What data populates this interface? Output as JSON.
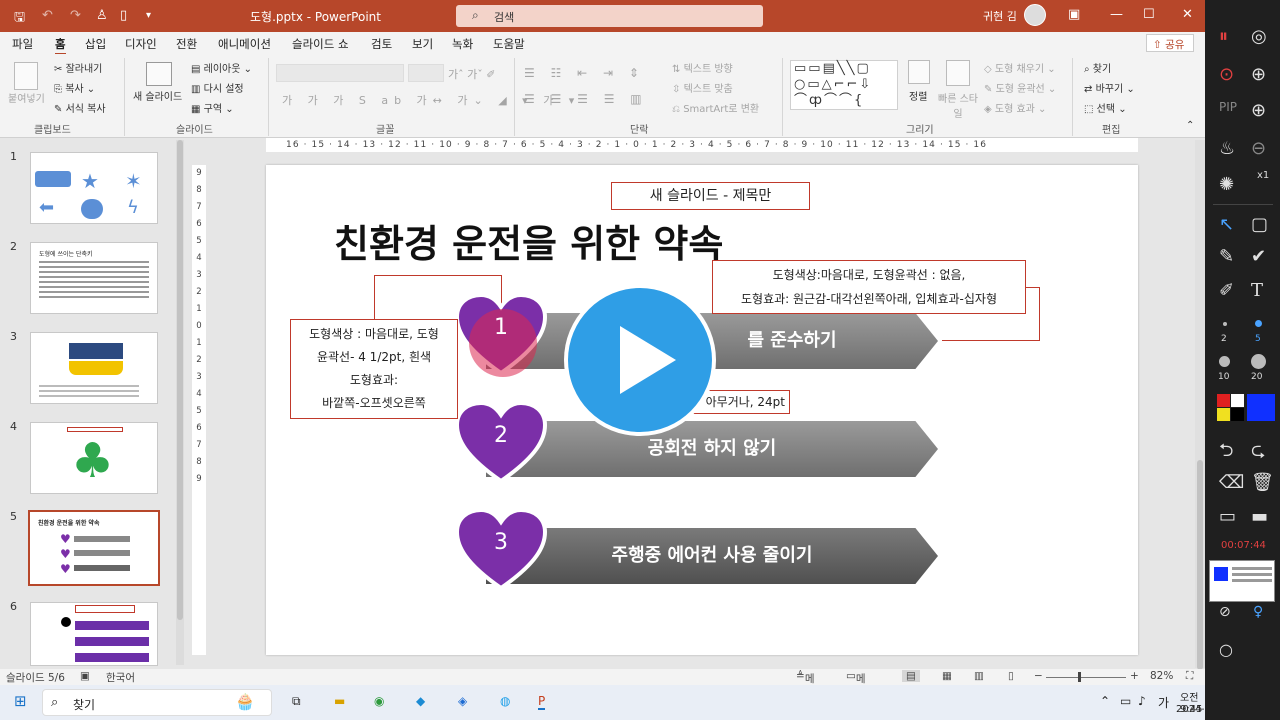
{
  "titlebar": {
    "doc": "도형.pptx  -  PowerPoint",
    "search": "검색",
    "user": "귀현 김"
  },
  "menu": [
    "파일",
    "홈",
    "삽입",
    "디자인",
    "전환",
    "애니메이션",
    "슬라이드 쇼",
    "검토",
    "보기",
    "녹화",
    "도움말"
  ],
  "share": "공유",
  "ribbon": {
    "paste": "붙여넣기",
    "cut": "잘라내기",
    "copy": "복사",
    "format_painter": "서식 복사",
    "new_slide": "새 슬라이드",
    "layout": "레이아웃",
    "reset": "다시 설정",
    "section": "구역",
    "text_dir": "텍스트 방향",
    "align_text": "텍스트 맞춤",
    "smartart": "SmartArt로 변환",
    "arrange": "정렬",
    "quick_styles": "빠른 스타일",
    "shape_fill": "도형 채우기",
    "shape_outline": "도형 윤곽선",
    "shape_effects": "도형 효과",
    "find": "찾기",
    "replace": "바꾸기",
    "select": "선택",
    "groups": {
      "clipboard": "클립보드",
      "slides": "슬라이드",
      "font": "글꼴",
      "paragraph": "단락",
      "drawing": "그리기",
      "editing": "편집"
    }
  },
  "ruler": {
    "h": "16 · 15 · 14 · 13 · 12 · 11 · 10 · 9 · 8 · 7 · 6 · 5 · 4 · 3 · 2 · 1 · 0 · 1 · 2 · 3 · 4 · 5 · 6 · 7 · 8 · 9 · 10 · 11 · 12 · 13 · 14 · 15 · 16",
    "v": [
      "9",
      "8",
      "7",
      "6",
      "5",
      "4",
      "3",
      "2",
      "1",
      "0",
      "1",
      "2",
      "3",
      "4",
      "5",
      "6",
      "7",
      "8",
      "9"
    ]
  },
  "thumbnails": [
    {
      "n": "1"
    },
    {
      "n": "2",
      "title": "도형에 쓰이는 단축키"
    },
    {
      "n": "3"
    },
    {
      "n": "4"
    },
    {
      "n": "5",
      "title": "친환경 운전을 위한 약속"
    },
    {
      "n": "6"
    }
  ],
  "slide": {
    "layout_label": "새 슬라이드 - 제목만",
    "title": "친환경 운전을 위한 약속",
    "note_right_1": "도형색상:마음대로, 도형윤곽선 : 없음,",
    "note_right_2": "도형효과: 원근감-대각선왼쪽아래, 입체효과-십자형",
    "note_left_1": "도형색상 : 마음대로, 도형",
    "note_left_2": "윤곽선- 4 1/2pt, 흰색",
    "note_left_3": "도형효과:",
    "note_left_4": "바깥쪽-오프셋오른쪽",
    "font_note": "아무거나, 24pt",
    "items": [
      {
        "num": "1",
        "text": "규정 속도 준수하기",
        "visible": "를 준수하기"
      },
      {
        "num": "2",
        "text": "공회전 하지 않기"
      },
      {
        "num": "3",
        "text": "주행중 에어컨 사용 줄이기"
      }
    ]
  },
  "status": {
    "slide": "슬라이드 5/6",
    "lang": "한국어",
    "notes": "메모",
    "comments": "메모",
    "zoom": "82%"
  },
  "taskbar": {
    "search": "찾기",
    "time": "오전 9:45",
    "date": "2024-12-06",
    "ime": "가"
  },
  "recorder": {
    "timer": "00:07:44",
    "sizes": [
      "2",
      "5",
      "10",
      "20"
    ],
    "zoom": "x1"
  },
  "colors": {
    "accent": "#b7472a",
    "heart": "#7b2fa8",
    "play": "#2f9ee6"
  }
}
